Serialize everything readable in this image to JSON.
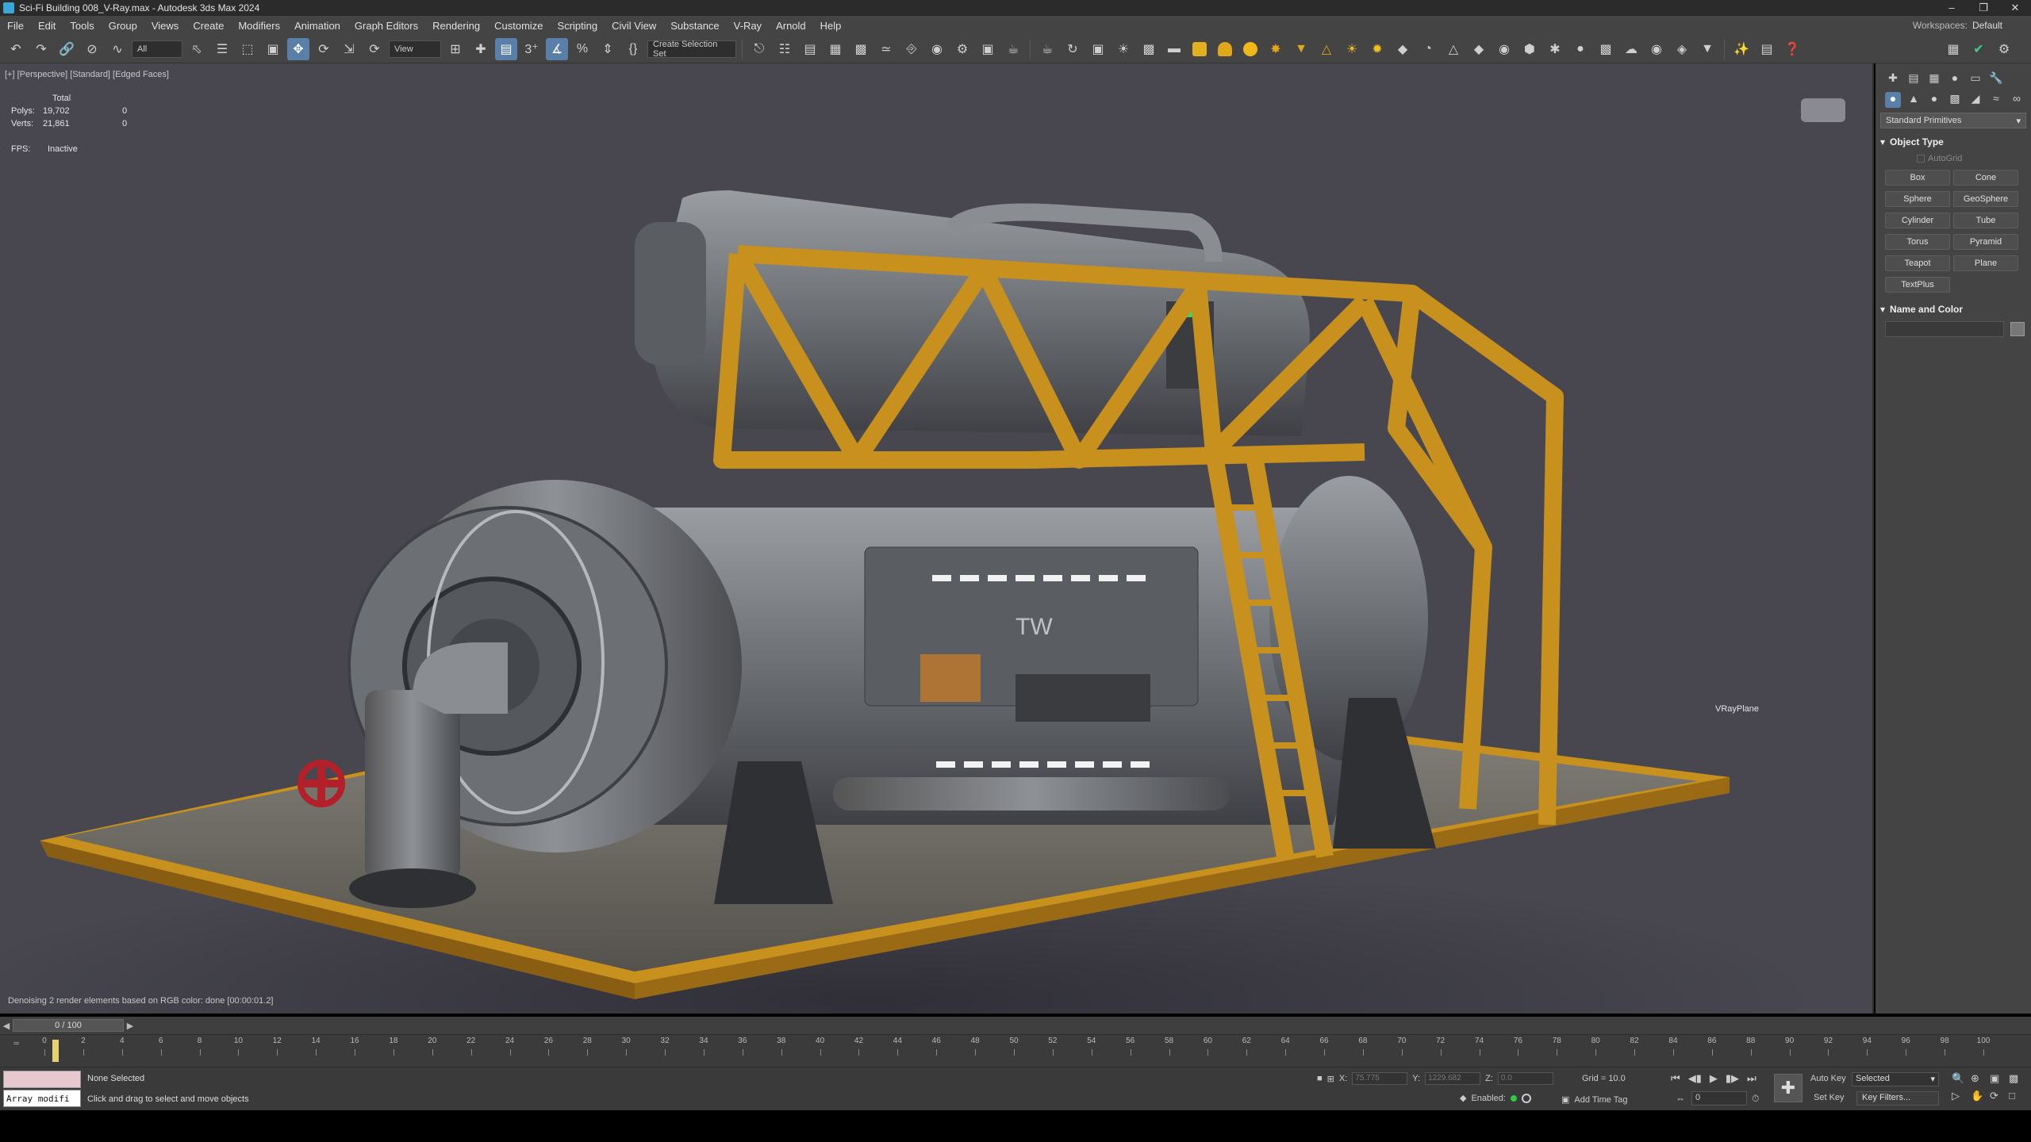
{
  "window": {
    "title": "Sci-Fi Building 008_V-Ray.max - Autodesk 3ds Max 2024"
  },
  "menu": [
    "File",
    "Edit",
    "Tools",
    "Group",
    "Views",
    "Create",
    "Modifiers",
    "Animation",
    "Graph Editors",
    "Rendering",
    "Customize",
    "Scripting",
    "Civil View",
    "Substance",
    "V-Ray",
    "Arnold",
    "Help"
  ],
  "workspace": {
    "label": "Workspaces:",
    "value": "Default"
  },
  "toolbar": {
    "selection_filter": "All",
    "ref_coord": "View",
    "named_selection": "Create Selection Set"
  },
  "viewport": {
    "label": "[+] [Perspective] [Standard] [Edged Faces]",
    "stats": {
      "total_label": "Total",
      "polys_label": "Polys:",
      "polys_total": "19,702",
      "polys_sel": "0",
      "verts_label": "Verts:",
      "verts_total": "21,861",
      "verts_sel": "0",
      "fps_label": "FPS:",
      "fps_value": "Inactive"
    },
    "object_label": "VRayPlane",
    "render_status": "Denoising 2 render elements based on RGB color: done [00:00:01.2]"
  },
  "command_panel": {
    "category": "Standard Primitives",
    "object_type_title": "Object Type",
    "autogrid": "AutoGrid",
    "buttons": [
      "Box",
      "Cone",
      "Sphere",
      "GeoSphere",
      "Cylinder",
      "Tube",
      "Torus",
      "Pyramid",
      "Teapot",
      "Plane",
      "TextPlus"
    ],
    "name_color_title": "Name and Color"
  },
  "timeline": {
    "slider": "0 / 100",
    "ticks": [
      "0",
      "2",
      "4",
      "6",
      "8",
      "10",
      "12",
      "14",
      "16",
      "18",
      "20",
      "22",
      "24",
      "26",
      "28",
      "30",
      "32",
      "34",
      "36",
      "38",
      "40",
      "42",
      "44",
      "46",
      "48",
      "50",
      "52",
      "54",
      "56",
      "58",
      "60",
      "62",
      "64",
      "66",
      "68",
      "70",
      "72",
      "74",
      "76",
      "78",
      "80",
      "82",
      "84",
      "86",
      "88",
      "90",
      "92",
      "94",
      "96",
      "98",
      "100"
    ]
  },
  "status": {
    "maxscript": "Array modifi",
    "selection": "None Selected",
    "prompt": "Click and drag to select and move objects",
    "x_label": "X:",
    "x_value": "75.775",
    "y_label": "Y:",
    "y_value": "1229.682",
    "z_label": "Z:",
    "z_value": "0.0",
    "grid": "Grid = 10.0",
    "enabled": "Enabled:",
    "add_time_tag": "Add Time Tag",
    "frame": "0",
    "auto_key": "Auto Key",
    "set_key": "Set Key",
    "selected": "Selected",
    "key_filters": "Key Filters..."
  },
  "colors": {
    "viewport_bg": "#484750",
    "frame_yellow": "#c8901c",
    "steel": "#7a7d82",
    "valve_red": "#b3202a"
  }
}
